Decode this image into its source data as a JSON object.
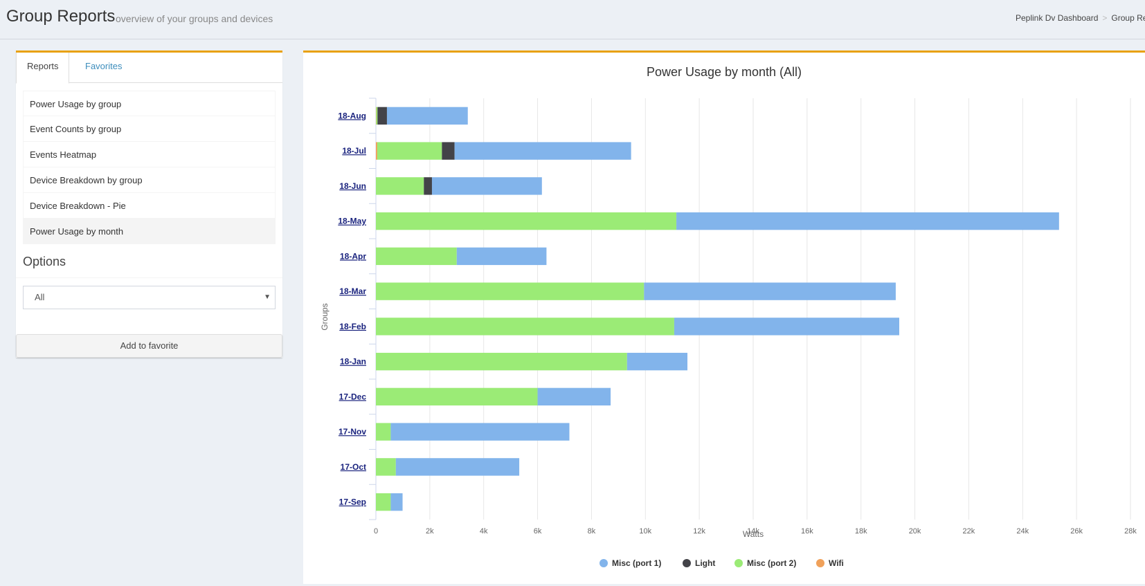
{
  "header": {
    "title": "Group Reports",
    "subtitle": "overview of your groups and devices",
    "breadcrumb": [
      "Peplink Dv Dashboard",
      "Group Reports"
    ]
  },
  "sidebar": {
    "tabs": [
      {
        "label": "Reports",
        "active": true
      },
      {
        "label": "Favorites",
        "active": false
      }
    ],
    "reports": [
      {
        "label": "Power Usage by group"
      },
      {
        "label": "Event Counts by group"
      },
      {
        "label": "Events Heatmap"
      },
      {
        "label": "Device Breakdown by group"
      },
      {
        "label": "Device Breakdown - Pie"
      },
      {
        "label": "Power Usage by month",
        "active": true
      }
    ],
    "options_title": "Options",
    "select_value": "All",
    "select_arrow": "▼",
    "favorite_button": "Add to favorite"
  },
  "colors": {
    "accent": "#e8a10b",
    "misc_port1": "#82b4eb",
    "light": "#434348",
    "misc_port2": "#9beb76",
    "wifi": "#f0a15a"
  },
  "chart_data": {
    "type": "bar",
    "orientation": "horizontal",
    "stacked": true,
    "title": "Power Usage by month (All)",
    "xlabel": "Watts",
    "ylabel": "Groups",
    "xlim": [
      0,
      28000
    ],
    "x_ticks": [
      "0",
      "2k",
      "4k",
      "6k",
      "8k",
      "10k",
      "12k",
      "14k",
      "16k",
      "18k",
      "20k",
      "22k",
      "24k",
      "26k",
      "28k"
    ],
    "grid": true,
    "legend_position": "bottom",
    "categories": [
      "18-Aug",
      "18-Jul",
      "18-Jun",
      "18-May",
      "18-Apr",
      "18-Mar",
      "18-Feb",
      "18-Jan",
      "17-Dec",
      "17-Nov",
      "17-Oct",
      "17-Sep"
    ],
    "series": [
      {
        "name": "Misc (port 1)",
        "color": "#82b4eb",
        "values": [
          3000,
          6550,
          4080,
          14200,
          3330,
          9340,
          8350,
          2240,
          2710,
          6630,
          4580,
          440
        ]
      },
      {
        "name": "Light",
        "color": "#434348",
        "values": [
          350,
          470,
          300,
          0,
          0,
          0,
          0,
          0,
          0,
          0,
          0,
          0
        ]
      },
      {
        "name": "Misc (port 2)",
        "color": "#9beb76",
        "values": [
          50,
          2400,
          1780,
          11150,
          3000,
          9950,
          11070,
          9320,
          6000,
          550,
          740,
          550
        ]
      },
      {
        "name": "Wifi",
        "color": "#f0a15a",
        "values": [
          10,
          50,
          0,
          0,
          0,
          0,
          0,
          0,
          0,
          0,
          0,
          0
        ]
      }
    ],
    "stack_order": [
      "Wifi",
      "Misc (port 2)",
      "Light",
      "Misc (port 1)"
    ]
  }
}
